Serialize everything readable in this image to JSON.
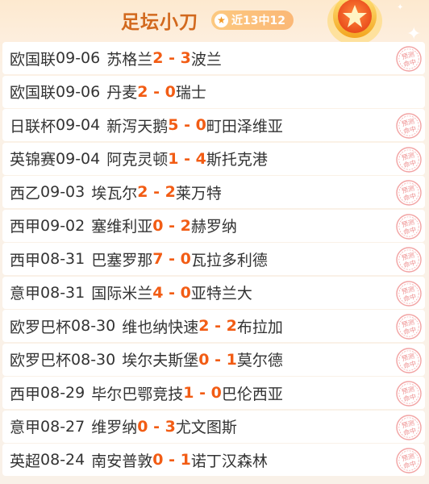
{
  "header": {
    "title": "足坛小刀",
    "record_badge": "近13中12",
    "badge_icon": "star-icon",
    "medal_icon": "star-medal-icon"
  },
  "stamp_text": "预测命中",
  "accent_color": "#f25c14",
  "matches": [
    {
      "league": "欧国联",
      "date": "09-06",
      "home": "苏格兰",
      "home_score": "2",
      "away_score": "3",
      "away": "波兰",
      "hit": true
    },
    {
      "league": "欧国联",
      "date": "09-06",
      "home": "丹麦",
      "home_score": "2",
      "away_score": "0",
      "away": "瑞士",
      "hit": false
    },
    {
      "league": "日联杯",
      "date": "09-04",
      "home": "新泻天鹅",
      "home_score": "5",
      "away_score": "0",
      "away": "町田泽维亚",
      "hit": true
    },
    {
      "league": "英锦赛",
      "date": "09-04",
      "home": "阿克灵顿",
      "home_score": "1",
      "away_score": "4",
      "away": "斯托克港",
      "hit": true
    },
    {
      "league": "西乙",
      "date": "09-03",
      "home": "埃瓦尔",
      "home_score": "2",
      "away_score": "2",
      "away": "莱万特",
      "hit": true
    },
    {
      "league": "西甲",
      "date": "09-02",
      "home": "塞维利亚",
      "home_score": "0",
      "away_score": "2",
      "away": "赫罗纳",
      "hit": true
    },
    {
      "league": "西甲",
      "date": "08-31",
      "home": "巴塞罗那",
      "home_score": "7",
      "away_score": "0",
      "away": "瓦拉多利德",
      "hit": true
    },
    {
      "league": "意甲",
      "date": "08-31",
      "home": "国际米兰",
      "home_score": "4",
      "away_score": "0",
      "away": "亚特兰大",
      "hit": true
    },
    {
      "league": "欧罗巴杯",
      "date": "08-30",
      "home": "维也纳快速",
      "home_score": "2",
      "away_score": "2",
      "away": "布拉加",
      "hit": true
    },
    {
      "league": "欧罗巴杯",
      "date": "08-30",
      "home": "埃尔夫斯堡",
      "home_score": "0",
      "away_score": "1",
      "away": "莫尔德",
      "hit": true
    },
    {
      "league": "西甲",
      "date": "08-29",
      "home": "毕尔巴鄂竞技",
      "home_score": "1",
      "away_score": "0",
      "away": "巴伦西亚",
      "hit": true
    },
    {
      "league": "意甲",
      "date": "08-27",
      "home": "维罗纳",
      "home_score": "0",
      "away_score": "3",
      "away": "尤文图斯",
      "hit": true
    },
    {
      "league": "英超",
      "date": "08-24",
      "home": "南安普敦",
      "home_score": "0",
      "away_score": "1",
      "away": "诺丁汉森林",
      "hit": true
    }
  ]
}
